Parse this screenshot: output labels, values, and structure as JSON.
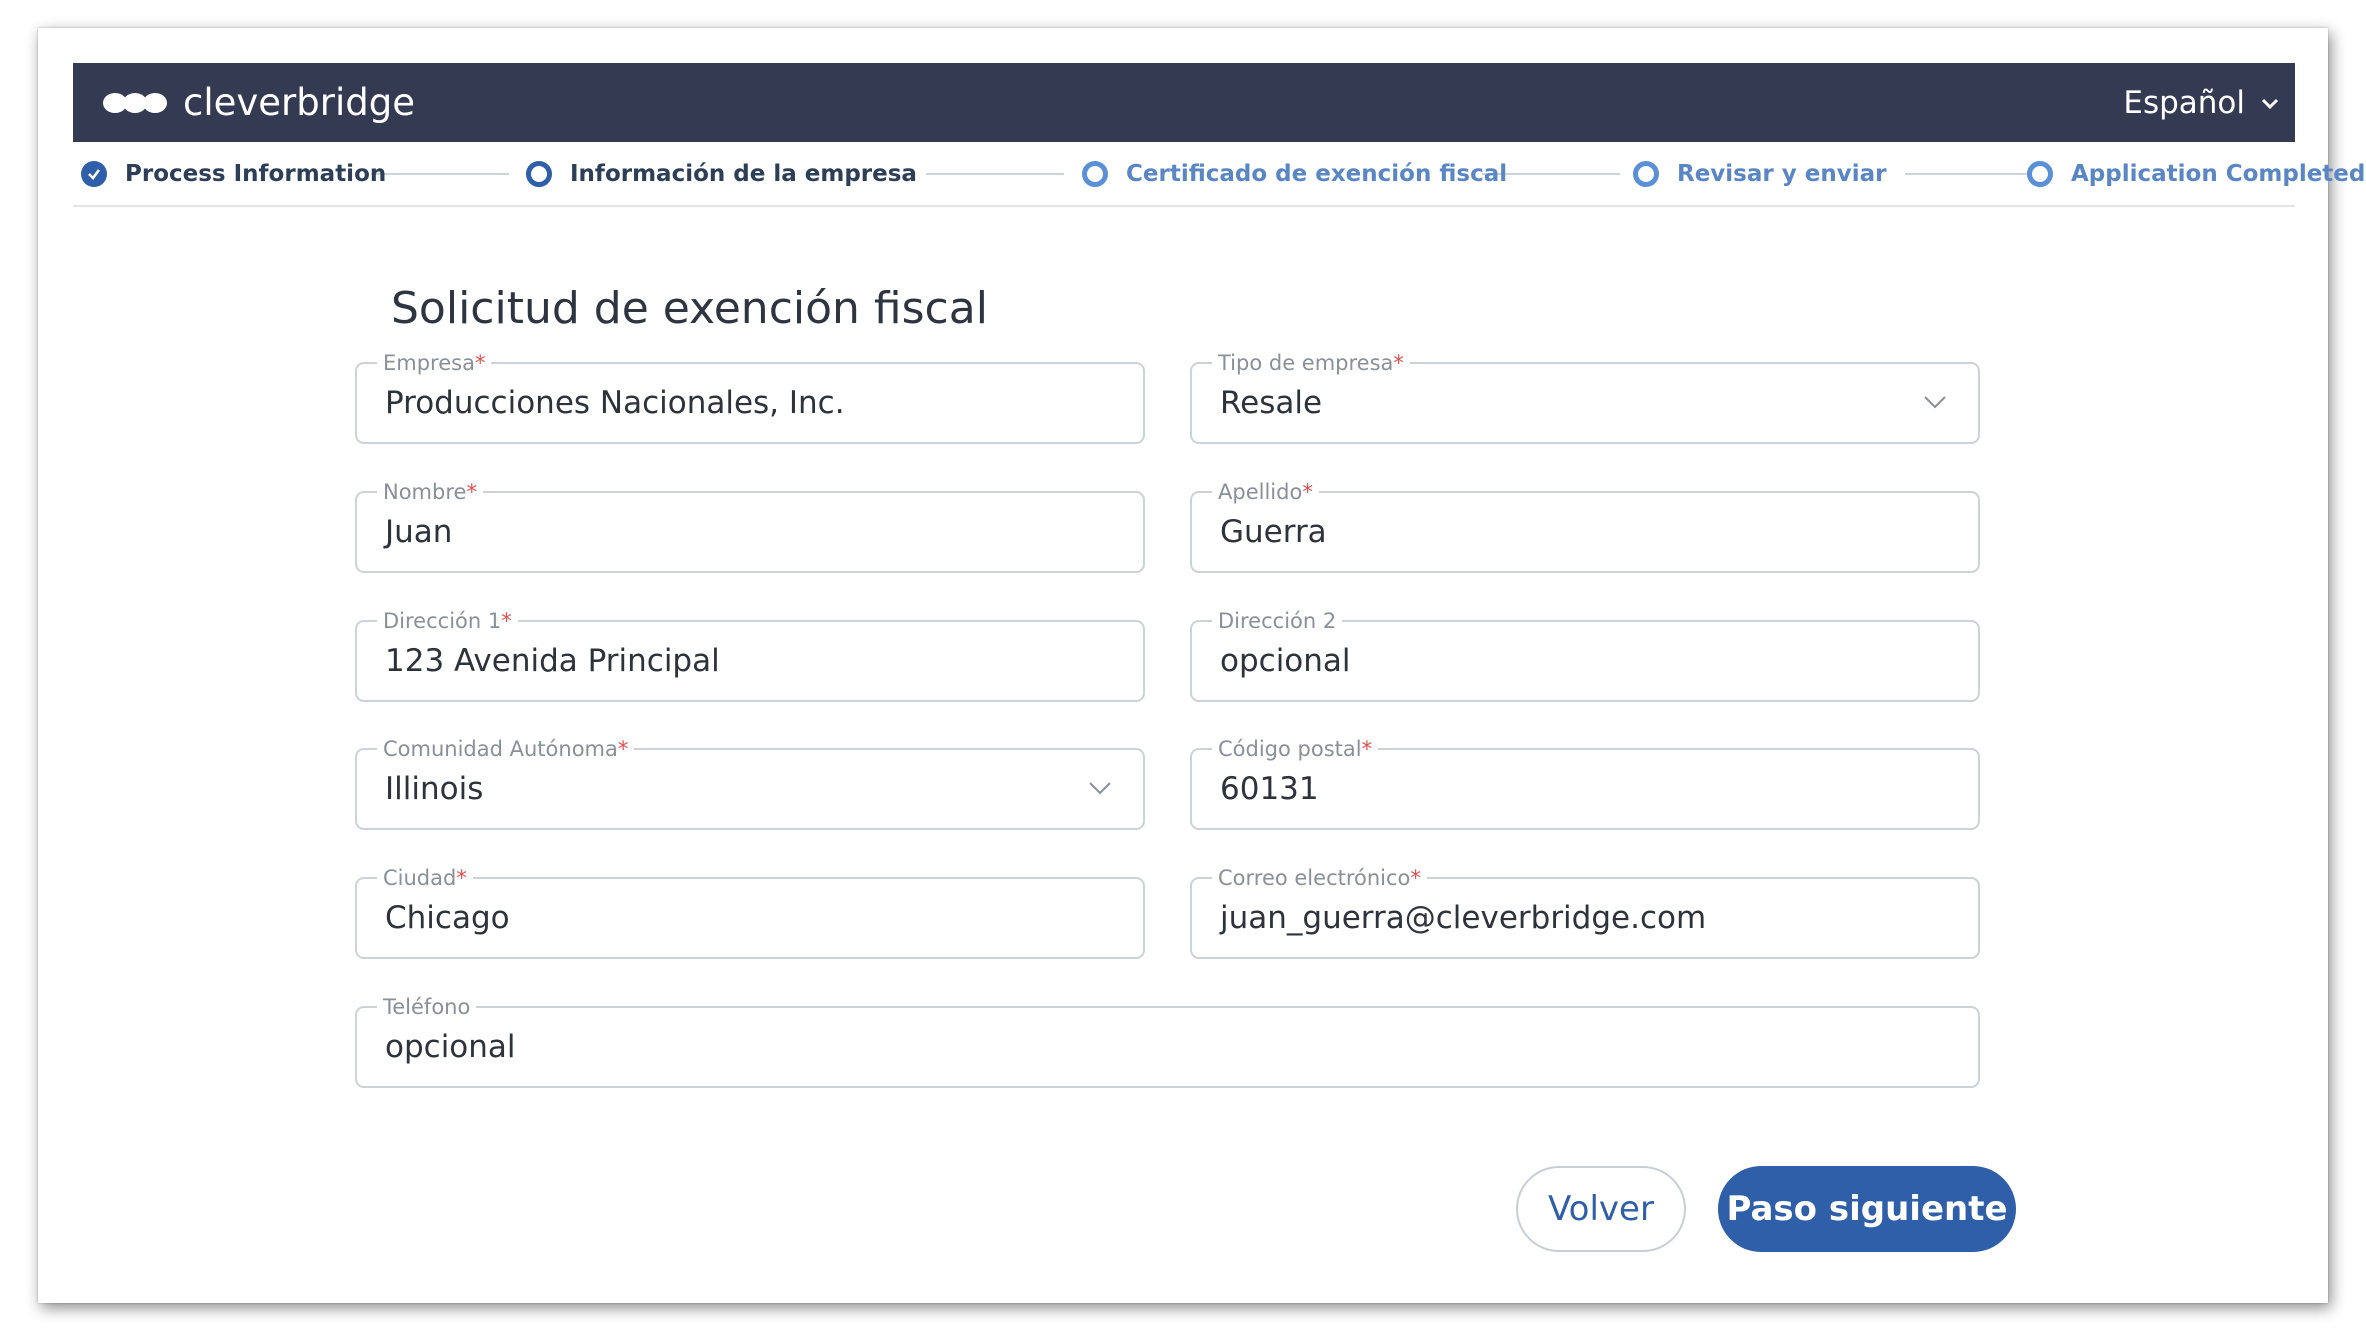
{
  "header": {
    "logo_text": "cleverbridge",
    "language": "Español",
    "colors": {
      "bar": "#343a51",
      "accent": "#2f5fa8"
    }
  },
  "steps": [
    {
      "label": "Process Information",
      "state": "done"
    },
    {
      "label": "Información de la empresa",
      "state": "active"
    },
    {
      "label": "Certificado de exención fiscal",
      "state": "pending"
    },
    {
      "label": "Revisar y enviar",
      "state": "pending"
    },
    {
      "label": "Application Completed",
      "state": "pending"
    }
  ],
  "form": {
    "title": "Solicitud de exención fiscal",
    "required_mark": "*",
    "fields": {
      "empresa": {
        "label": "Empresa",
        "value": "Producciones Nacionales, Inc."
      },
      "tipo_empresa": {
        "label": "Tipo de empresa",
        "value": "Resale"
      },
      "nombre": {
        "label": "Nombre",
        "value": "Juan"
      },
      "apellido": {
        "label": "Apellido",
        "value": "Guerra"
      },
      "direccion1": {
        "label": "Dirección 1",
        "value": "123 Avenida Principal"
      },
      "direccion2": {
        "label": "Dirección 2",
        "value": "opcional"
      },
      "comunidad": {
        "label": "Comunidad Autónoma",
        "value": "Illinois"
      },
      "codigo_postal": {
        "label": "Código postal",
        "value": "60131"
      },
      "ciudad": {
        "label": "Ciudad",
        "value": "Chicago"
      },
      "correo": {
        "label": "Correo electrónico",
        "value": "juan_guerra@cleverbridge.com"
      },
      "telefono": {
        "label": "Teléfono",
        "value": "opcional"
      }
    },
    "buttons": {
      "back": "Volver",
      "next": "Paso siguiente"
    }
  }
}
